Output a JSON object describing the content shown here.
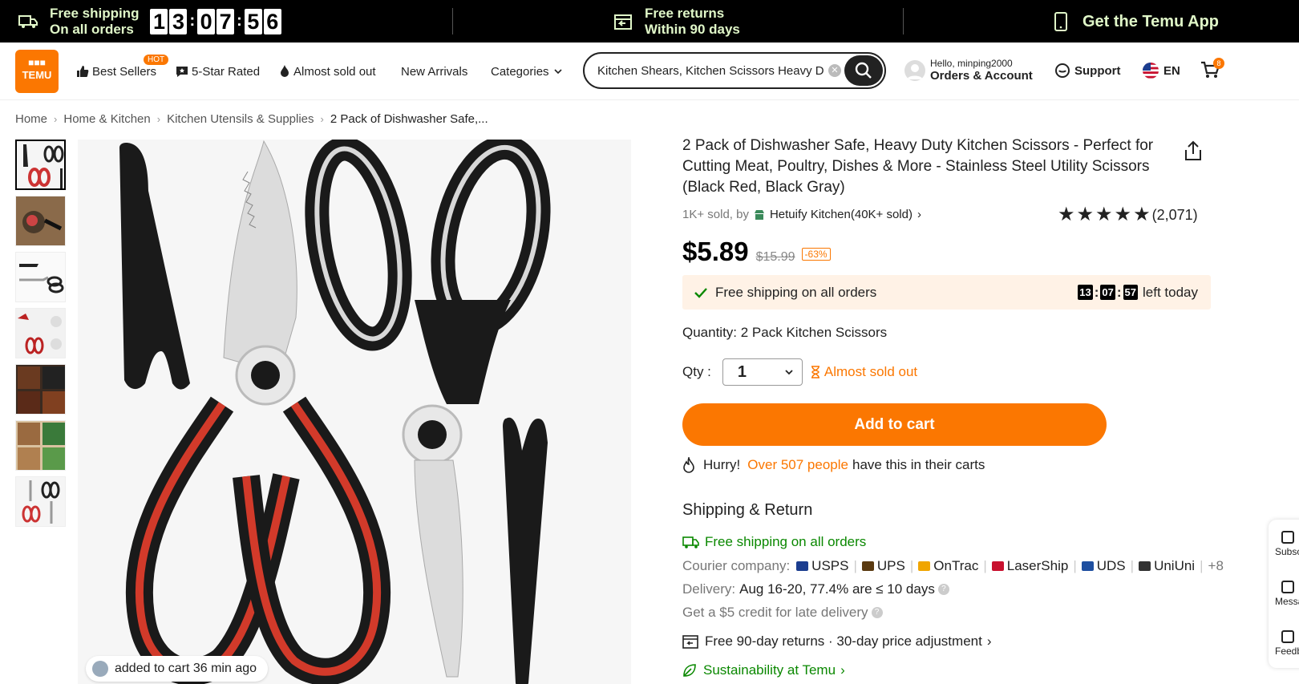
{
  "topbar": {
    "shipping_title": "Free shipping",
    "shipping_sub": "On all orders",
    "countdown": [
      "1",
      "3",
      "0",
      "7",
      "5",
      "6"
    ],
    "returns_title": "Free returns",
    "returns_sub": "Within 90 days",
    "app_label": "Get the Temu App"
  },
  "header": {
    "logo_text": "TEMU",
    "nav": {
      "best_sellers": "Best Sellers",
      "hot_badge": "HOT",
      "five_star": "5-Star Rated",
      "almost_sold": "Almost sold out",
      "new_arrivals": "New Arrivals",
      "categories": "Categories"
    },
    "search": {
      "value": "Kitchen Shears, Kitchen Scissors Heavy Duty"
    },
    "account": {
      "hello": "Hello, minping2000",
      "label": "Orders & Account"
    },
    "support": "Support",
    "language": "EN",
    "cart_count": "8"
  },
  "breadcrumb": [
    "Home",
    "Home & Kitchen",
    "Kitchen Utensils & Supplies",
    "2 Pack of Dishwasher Safe,..."
  ],
  "gallery": {
    "thumb_count": 7,
    "added_to_cart": "added to cart 36 min ago"
  },
  "product": {
    "title": "2 Pack of Dishwasher Safe, Heavy Duty Kitchen Scissors - Perfect for Cutting Meat, Poultry, Dishes & More - Stainless Steel Utility Scissors (Black Red, Black Gray)",
    "sold": "1K+ sold, by",
    "seller": "Hetuify Kitchen(40K+ sold)",
    "rating_count": "(2,071)",
    "rating_value": 4.8,
    "price": "$5.89",
    "old_price": "$15.99",
    "discount": "-63%",
    "ship_text": "Free shipping on all orders",
    "timer": [
      "13",
      "07",
      "57"
    ],
    "timer_suffix": "left today",
    "quantity_label": "Quantity: 2 Pack Kitchen Scissors",
    "qty_label": "Qty :",
    "qty_value": "1",
    "almost_sold": "Almost sold out",
    "add_to_cart": "Add to cart",
    "hurry_prefix": "Hurry!",
    "hurry_count": "Over 507 people",
    "hurry_suffix": "have this in their carts"
  },
  "shipping": {
    "title": "Shipping & Return",
    "free": "Free shipping on all orders",
    "courier_label": "Courier company:",
    "couriers": [
      {
        "name": "USPS",
        "color": "#1b3d8f"
      },
      {
        "name": "UPS",
        "color": "#5a3a10"
      },
      {
        "name": "OnTrac",
        "color": "#f0a500"
      },
      {
        "name": "LaserShip",
        "color": "#c8102e"
      },
      {
        "name": "UDS",
        "color": "#1e4fa0"
      },
      {
        "name": "UniUni",
        "color": "#333333"
      }
    ],
    "more": "+8",
    "delivery_label": "Delivery:",
    "delivery_value": "Aug 16-20, 77.4% are ≤ 10 days",
    "credit": "Get a $5 credit for late delivery",
    "returns": "Free 90-day returns · 30-day price adjustment",
    "sustain": "Sustainability at Temu"
  },
  "side_panel": [
    "Subsc",
    "Messa",
    "Feedb"
  ],
  "colors": {
    "accent": "#fb7701",
    "green": "#0a8800",
    "topbar": "#000000"
  }
}
